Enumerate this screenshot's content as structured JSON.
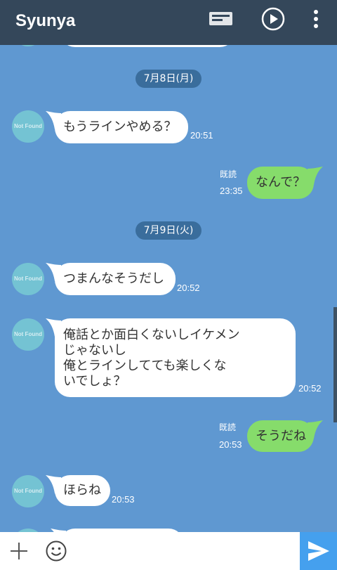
{
  "header": {
    "title": "Syunya",
    "icons": {
      "notes": "notes-icon",
      "play": "play-circle-icon",
      "menu": "more-vertical-icon"
    }
  },
  "colors": {
    "header_bg": "#34475a",
    "chat_bg": "#5f98d1",
    "date_chip_bg": "#3a6d9c",
    "bubble_incoming": "#ffffff",
    "bubble_outgoing": "#86dc6b",
    "avatar_bg": "#74c3d3",
    "send_button_bg": "#45a0ee",
    "scrollbar": "#3b4a58"
  },
  "avatar_placeholder_text": "Not Found",
  "date_separators": [
    "7月8日(月)",
    "7月9日(火)"
  ],
  "messages": [
    {
      "lines": [
        "もうラインやめる？"
      ],
      "time": "20:51"
    },
    {
      "lines": [
        "なんで？"
      ],
      "read": "既読",
      "time": "23:35"
    },
    {
      "lines": [
        "つまんなそうだし"
      ],
      "time": "20:52"
    },
    {
      "lines": [
        "俺話とか面白くないしイケメン",
        "じゃないし",
        "俺とラインしてても楽しくな",
        "いでしょ？"
      ],
      "time": "20:52"
    },
    {
      "lines": [
        "そうだね"
      ],
      "read": "既読",
      "time": "20:53"
    },
    {
      "lines": [
        "ほらね"
      ],
      "time": "20:53"
    }
  ],
  "input_bar": {
    "icons": {
      "add": "plus-icon",
      "emoji": "smiley-icon",
      "send": "send-icon"
    }
  }
}
